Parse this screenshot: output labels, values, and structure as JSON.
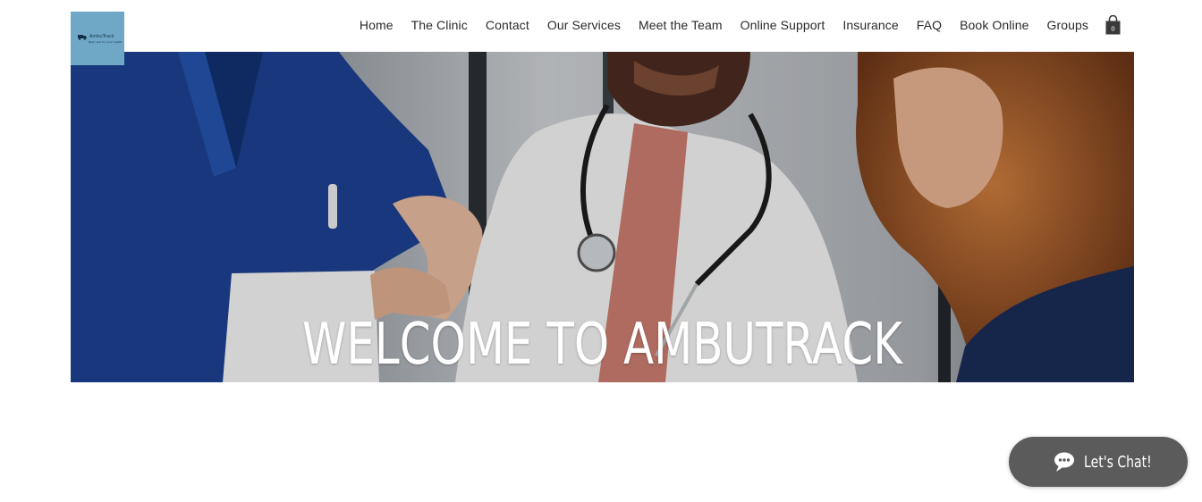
{
  "header": {
    "logo": {
      "name": "AmbuTrack",
      "tagline": "Best care for your health"
    },
    "nav": [
      "Home",
      "The Clinic",
      "Contact",
      "Our Services",
      "Meet the Team",
      "Online Support",
      "Insurance",
      "FAQ",
      "Book Online",
      "Groups"
    ],
    "cart": {
      "count": "0",
      "icon": "shopping-bag-icon"
    }
  },
  "hero": {
    "title": "WELCOME TO AMBUTRACK"
  },
  "chat": {
    "label": "Let's Chat!",
    "icon": "chat-bubbles-icon"
  },
  "colors": {
    "logo_bg": "#6fa8c6",
    "nav_text": "#2a2a2a",
    "chat_bg": "#5b5b5b"
  }
}
